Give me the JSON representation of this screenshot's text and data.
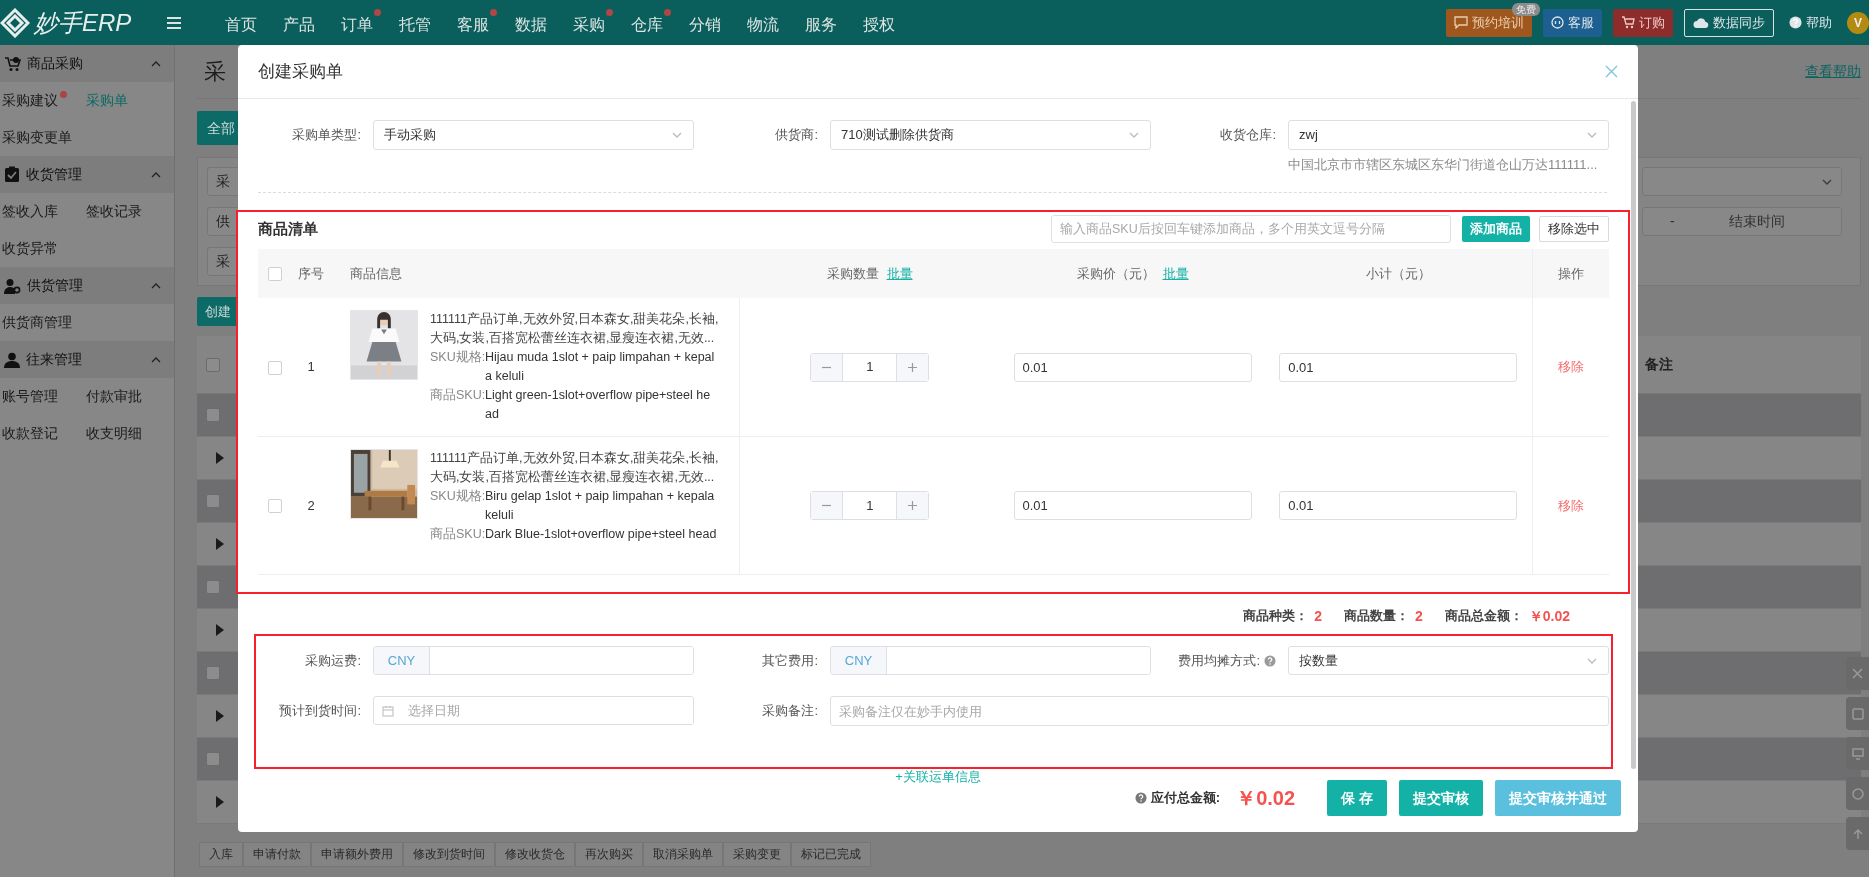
{
  "navbar": {
    "logo": "妙手ERP",
    "items": [
      {
        "label": "首页",
        "dot": false
      },
      {
        "label": "产品",
        "dot": false
      },
      {
        "label": "订单",
        "dot": true
      },
      {
        "label": "托管",
        "dot": false
      },
      {
        "label": "客服",
        "dot": true
      },
      {
        "label": "数据",
        "dot": false
      },
      {
        "label": "采购",
        "dot": true
      },
      {
        "label": "仓库",
        "dot": true
      },
      {
        "label": "分销",
        "dot": false
      },
      {
        "label": "物流",
        "dot": false
      },
      {
        "label": "服务",
        "dot": false
      },
      {
        "label": "授权",
        "dot": false
      }
    ],
    "actions": [
      {
        "kind": "training",
        "label": "预约培训",
        "badge": "免费"
      },
      {
        "kind": "service",
        "label": "客服"
      },
      {
        "kind": "order",
        "label": "订购"
      },
      {
        "kind": "sync",
        "label": "数据同步"
      },
      {
        "kind": "help",
        "label": "帮助"
      }
    ],
    "avatar": "V"
  },
  "sidebar": {
    "groups": [
      {
        "title": "商品采购",
        "expanded": true,
        "items": [
          {
            "label": "采购建议",
            "dot": true,
            "selected": false
          },
          {
            "label": "采购单",
            "dot": false,
            "selected": true
          },
          {
            "label": "采购变更单",
            "dot": false,
            "selected": false
          }
        ]
      },
      {
        "title": "收货管理",
        "expanded": true,
        "items": [
          {
            "label": "签收入库",
            "dot": false,
            "selected": false
          },
          {
            "label": "签收记录",
            "dot": false,
            "selected": false
          },
          {
            "label": "收货异常",
            "dot": false,
            "selected": false
          }
        ]
      },
      {
        "title": "供货管理",
        "expanded": true,
        "items": [
          {
            "label": "供货商管理",
            "dot": false,
            "selected": false
          }
        ]
      },
      {
        "title": "往来管理",
        "expanded": true,
        "items": [
          {
            "label": "账号管理",
            "dot": false,
            "selected": false
          },
          {
            "label": "付款审批",
            "dot": false,
            "selected": false
          },
          {
            "label": "收款登记",
            "dot": false,
            "selected": false
          },
          {
            "label": "收支明细",
            "dot": false,
            "selected": false
          }
        ]
      }
    ]
  },
  "page": {
    "title": "采",
    "help_link": "查看帮助",
    "tab": "全部",
    "filters": [
      "采",
      "供",
      "采"
    ],
    "date_range": {
      "separator": "-",
      "end_placeholder": "结束时间"
    },
    "create_button": "创建",
    "table": {
      "all_checked": false,
      "last_column": "备注",
      "rows": [
        {
          "kind": "order",
          "checked": false
        },
        {
          "kind": "detail"
        },
        {
          "kind": "order",
          "checked": false
        },
        {
          "kind": "detail"
        },
        {
          "kind": "order",
          "checked": false
        },
        {
          "kind": "detail"
        },
        {
          "kind": "order",
          "checked": false
        },
        {
          "kind": "detail"
        },
        {
          "kind": "order",
          "checked": false
        },
        {
          "kind": "detail"
        }
      ]
    },
    "bulk_actions": [
      "入库",
      "申请付款",
      "申请额外费用",
      "修改到货时间",
      "修改收货仓",
      "再次购买",
      "取消采购单",
      "采购变更",
      "标记已完成"
    ]
  },
  "modal": {
    "title": "创建采购单",
    "fields": [
      {
        "label": "采购单类型:",
        "value": "手动采购"
      },
      {
        "label": "供货商:",
        "value": "710测试删除供货商"
      },
      {
        "label": "收货仓库:",
        "value": "zwj",
        "note": "中国北京市市辖区东城区东华门街道仓山万达111111..."
      }
    ],
    "goods": {
      "title": "商品清单",
      "sku_input": {
        "placeholder": "输入商品SKU后按回车键添加商品，多个用英文逗号分隔"
      },
      "add_button": "添加商品",
      "remove_button": "移除选中",
      "all_checked": false,
      "columns": [
        {
          "label": "序号"
        },
        {
          "label": "商品信息"
        },
        {
          "label": "采购数量",
          "link": "批量"
        },
        {
          "label": "采购价（元）",
          "link": "批量"
        },
        {
          "label": "小计（元）"
        },
        {
          "label": "操作"
        }
      ],
      "rows": [
        {
          "checked": false,
          "index": "1",
          "name": "111111产品订单,无效外贸,日本森女,甜美花朵,长袖,大码,女装,百搭宽松蕾丝连衣裙,显瘦连衣裙,无效...",
          "sku_label": "SKU规格:",
          "sku_spec": "Hijau muda 1slot + paip limpahan + kepala keluli",
          "code_label": "商品SKU:",
          "code": "Light green-1slot+overflow pipe+steel head",
          "quantity": "1",
          "price": "0.01",
          "subtotal": "0.01",
          "action": "移除"
        },
        {
          "checked": false,
          "index": "2",
          "name": "111111产品订单,无效外贸,日本森女,甜美花朵,长袖,大码,女装,百搭宽松蕾丝连衣裙,显瘦连衣裙,无效...",
          "sku_label": "SKU规格:",
          "sku_spec": "Biru gelap 1slot + paip limpahan + kepala keluli",
          "code_label": "商品SKU:",
          "code": "Dark Blue-1slot+overflow pipe+steel head",
          "quantity": "1",
          "price": "0.01",
          "subtotal": "0.01",
          "action": "移除"
        }
      ]
    },
    "summary": [
      {
        "label": "商品种类：",
        "value": "2"
      },
      {
        "label": "商品数量：",
        "value": "2"
      },
      {
        "label": "商品总金额：",
        "value": "￥0.02"
      }
    ],
    "costs": {
      "freight": {
        "label": "采购运费:",
        "currency": "CNY"
      },
      "other": {
        "label": "其它费用:",
        "currency": "CNY"
      },
      "split": {
        "label": "费用均摊方式:",
        "value": "按数量"
      },
      "arrival": {
        "label": "预计到货时间:",
        "placeholder": "选择日期"
      },
      "remark": {
        "label": "采购备注:",
        "placeholder": "采购备注仅在妙手内使用"
      }
    },
    "waybill_link": "+关联运单信息",
    "footer": {
      "total_label": "应付总金额:",
      "total": "￥0.02",
      "buttons": [
        {
          "label": "保 存",
          "kind": "primary"
        },
        {
          "label": "提交审核",
          "kind": "primary"
        },
        {
          "label": "提交审核并通过",
          "kind": "light"
        }
      ]
    }
  }
}
